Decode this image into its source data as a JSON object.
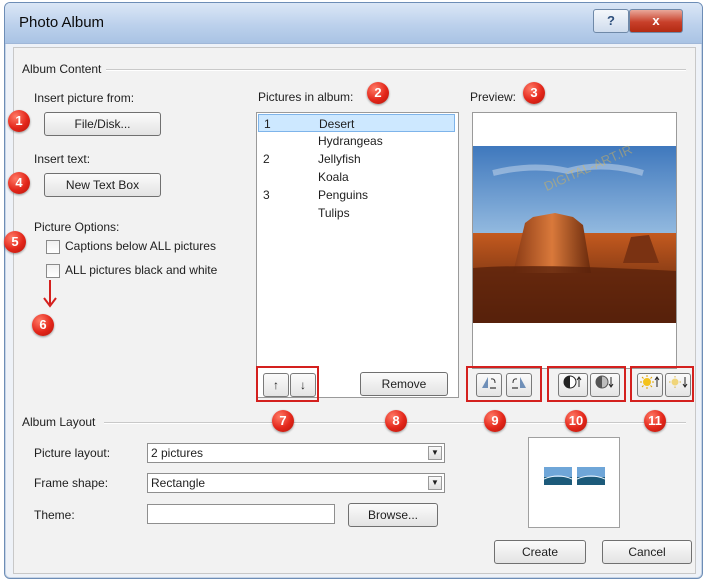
{
  "window": {
    "title": "Photo Album",
    "help_glyph": "?",
    "close_glyph": "x"
  },
  "album_content": {
    "group_label": "Album Content",
    "insert_picture_label": "Insert picture from:",
    "file_disk_button": "File/Disk...",
    "insert_text_label": "Insert text:",
    "new_text_box_button": "New Text Box",
    "picture_options_label": "Picture Options:",
    "captions_checkbox": {
      "label": "Captions below ALL pictures",
      "checked": false
    },
    "bw_checkbox": {
      "label": "ALL pictures black and white",
      "checked": false
    }
  },
  "pictures": {
    "label": "Pictures in album:",
    "items": [
      {
        "number": "1",
        "name": "Desert",
        "selected": true
      },
      {
        "number": "",
        "name": "Hydrangeas",
        "selected": false
      },
      {
        "number": "2",
        "name": "Jellyfish",
        "selected": false
      },
      {
        "number": "",
        "name": "Koala",
        "selected": false
      },
      {
        "number": "3",
        "name": "Penguins",
        "selected": false
      },
      {
        "number": "",
        "name": "Tulips",
        "selected": false
      }
    ],
    "move_up_glyph": "↑",
    "move_down_glyph": "↓",
    "remove_button": "Remove"
  },
  "preview": {
    "label": "Preview:",
    "watermark": "DIGITAL-ART.IR",
    "rotate_left_icon": "rotate-left-icon",
    "rotate_right_icon": "rotate-right-icon",
    "contrast_up_icon": "contrast-up-icon",
    "contrast_down_icon": "contrast-down-icon",
    "brightness_up_icon": "brightness-up-icon",
    "brightness_down_icon": "brightness-down-icon"
  },
  "album_layout": {
    "group_label": "Album Layout",
    "picture_layout_label": "Picture layout:",
    "picture_layout_value": "2 pictures",
    "frame_shape_label": "Frame shape:",
    "frame_shape_value": "Rectangle",
    "theme_label": "Theme:",
    "theme_value": "",
    "browse_button": "Browse..."
  },
  "footer": {
    "create_button": "Create",
    "cancel_button": "Cancel"
  },
  "annotations": [
    "1",
    "2",
    "3",
    "4",
    "5",
    "6",
    "7",
    "8",
    "9",
    "10",
    "11"
  ],
  "colors": {
    "annotation_red": "#d4201e",
    "selection_blue": "#cde8ff"
  }
}
